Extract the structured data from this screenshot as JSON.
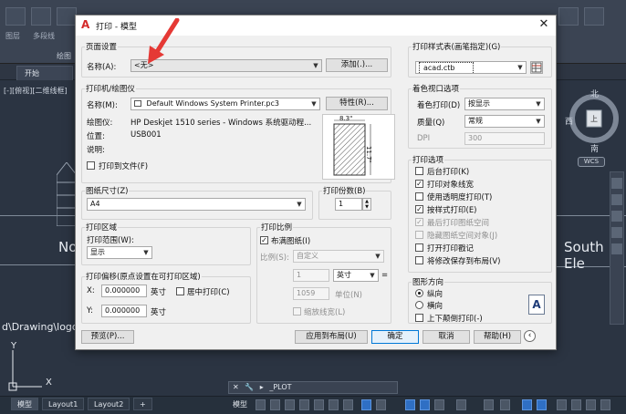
{
  "background": {
    "tab_start": "开始",
    "viewport_label": "[-][俯视][二维线框]",
    "text_left": "No",
    "text_right": "South Ele",
    "path_text": "d\\Drawing\\logo",
    "ribbon_labels": [
      "图层",
      "多段线",
      "绘图"
    ],
    "compass": {
      "north": "北",
      "south": "南",
      "west": "西",
      "top": "上",
      "wcs": "WCS"
    },
    "ucs_y": "Y",
    "ucs_x": "X",
    "command": "_PLOT",
    "layout_tabs": [
      "模型",
      "Layout1",
      "Layout2"
    ],
    "add_tab": "+",
    "status_model": "模型"
  },
  "dialog": {
    "title": "打印 - 模型",
    "page_setup": {
      "label": "页面设置",
      "name_label": "名称(A):",
      "name_value": "<无>",
      "add_button": "添加(.)..."
    },
    "printer": {
      "label": "打印机/绘图仪",
      "name_label": "名称(M):",
      "name_value": "Default Windows System Printer.pc3",
      "properties_button": "特性(R)...",
      "plotter_label": "绘图仪:",
      "plotter_value": "HP Deskjet 1510 series - Windows 系统驱动程...",
      "location_label": "位置:",
      "location_value": "USB001",
      "description_label": "说明:",
      "print_to_file": "打印到文件(F)",
      "preview_width": "8.3\"",
      "preview_height": "11.7\""
    },
    "paper_size": {
      "label": "图纸尺寸(Z)",
      "value": "A4"
    },
    "copies": {
      "label": "打印份数(B)",
      "value": "1"
    },
    "plot_area": {
      "label": "打印区域",
      "range_label": "打印范围(W):",
      "range_value": "显示"
    },
    "plot_offset": {
      "label": "打印偏移(原点设置在可打印区域)",
      "x_label": "X:",
      "x_value": "0.000000",
      "x_unit": "英寸",
      "center_plot": "居中打印(C)",
      "y_label": "Y:",
      "y_value": "0.000000",
      "y_unit": "英寸"
    },
    "plot_scale": {
      "label": "打印比例",
      "fit_paper": "布满图纸(I)",
      "scale_label": "比例(S):",
      "scale_value": "自定义",
      "value1": "1",
      "unit1": "英寸",
      "equals": "=",
      "value2": "1059",
      "unit2": "单位(N)",
      "scale_lineweights": "缩放线宽(L)"
    },
    "plot_style": {
      "label": "打印样式表(画笔指定)(G)",
      "value": "acad.ctb"
    },
    "shaded_viewport": {
      "label": "着色视口选项",
      "shade_label": "着色打印(D)",
      "shade_value": "按显示",
      "quality_label": "质量(Q)",
      "quality_value": "常规",
      "dpi_label": "DPI",
      "dpi_value": "300"
    },
    "plot_options": {
      "label": "打印选项",
      "items": [
        {
          "text": "后台打印(K)",
          "checked": false,
          "disabled": false
        },
        {
          "text": "打印对象线宽",
          "checked": true,
          "disabled": false
        },
        {
          "text": "使用透明度打印(T)",
          "checked": false,
          "disabled": false
        },
        {
          "text": "按样式打印(E)",
          "checked": true,
          "disabled": false
        },
        {
          "text": "最后打印图纸空间",
          "checked": true,
          "disabled": true
        },
        {
          "text": "隐藏图纸空间对象(J)",
          "checked": false,
          "disabled": true
        },
        {
          "text": "打开打印戳记",
          "checked": false,
          "disabled": false
        },
        {
          "text": "将修改保存到布局(V)",
          "checked": false,
          "disabled": false
        }
      ]
    },
    "orientation": {
      "label": "图形方向",
      "portrait": "纵向",
      "landscape": "横向",
      "upside_down": "上下颠倒打印(-)",
      "icon_letter": "A"
    },
    "buttons": {
      "preview": "预览(P)...",
      "apply_layout": "应用到布局(U)",
      "ok": "确定",
      "cancel": "取消",
      "help": "帮助(H)"
    }
  }
}
